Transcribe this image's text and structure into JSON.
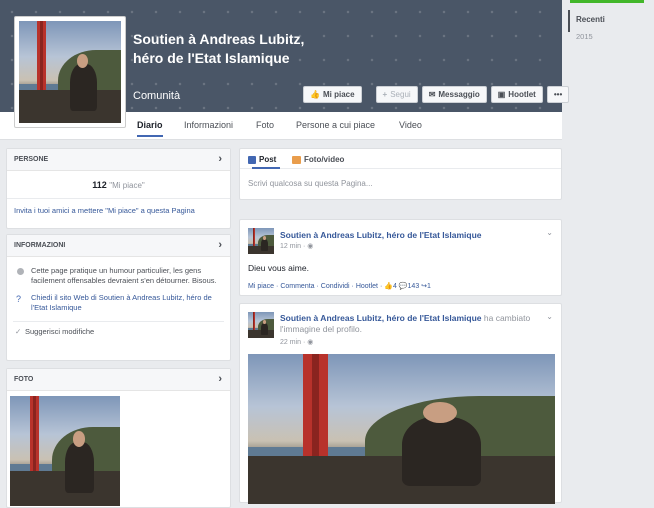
{
  "page": {
    "name": "Soutien à Andreas Lubitz, héro de l'Etat Islamique",
    "category": "Comunità"
  },
  "actions": {
    "like": "Mi piace",
    "follow": "Segui",
    "message": "Messaggio",
    "hootlet": "Hootlet",
    "more": "•••"
  },
  "tabs": [
    "Diario",
    "Informazioni",
    "Foto",
    "Persone a cui piace",
    "Video"
  ],
  "left": {
    "people": {
      "header": "PERSONE",
      "likes_count": "112",
      "likes_label": "\"Mi piace\"",
      "invite": "Invita i tuoi amici a mettere \"Mi piace\" a questa Pagina"
    },
    "info": {
      "header": "INFORMAZIONI",
      "desc": "Cette page pratique un humour particulier, les gens facilement offensables devraient s'en détourner. Bisous.",
      "website": "Chiedi il sito Web di Soutien à Andreas Lubitz, héro de l'Etat Islamique",
      "suggest": "Suggerisci modifiche"
    },
    "photos": {
      "header": "FOTO"
    }
  },
  "composer": {
    "tab_post": "Post",
    "tab_photo": "Foto/video",
    "placeholder": "Scrivi qualcosa su questa Pagina..."
  },
  "post1": {
    "author": "Soutien à Andreas Lubitz, héro de l'Etat Islamique",
    "time": "12 min",
    "text": "Dieu vous aime.",
    "like": "Mi piace",
    "comment": "Commenta",
    "share": "Condividi",
    "hootlet": "Hootlet",
    "likes": "4",
    "comments": "143",
    "shares": "1"
  },
  "post2": {
    "author": "Soutien à Andreas Lubitz, héro de l'Etat Islamique",
    "action": "ha cambiato l'immagine del profilo.",
    "time": "22 min"
  },
  "timeline": {
    "recent": "Recenti",
    "year": "2015"
  },
  "colors": {
    "accent": "#4267b2",
    "link": "#365899",
    "green": "#42b72a"
  }
}
